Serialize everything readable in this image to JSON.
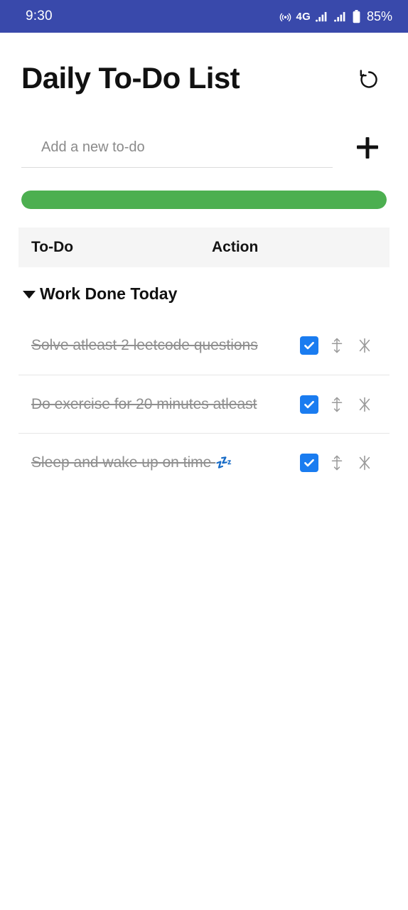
{
  "status_bar": {
    "time": "9:30",
    "hotspot_icon": "hotspot-icon",
    "network_label": "4G",
    "signal_icon_1": "signal-bars-icon",
    "signal_icon_2": "signal-bars-icon",
    "battery_icon": "battery-icon",
    "battery_percent": "85%",
    "background_color": "#3949ab"
  },
  "header": {
    "title": "Daily To-Do List",
    "reset_icon": "reset-circular-arrow-icon"
  },
  "add_todo": {
    "placeholder": "Add a new to-do",
    "value": "",
    "add_icon": "plus-icon"
  },
  "progress": {
    "percent": 100,
    "percent_label": "100%",
    "fill_color": "#4caf50",
    "track_color": "#e8e8e8"
  },
  "table": {
    "columns": [
      "To-Do",
      "Action"
    ],
    "group": {
      "label": "Work Done Today",
      "expanded": true,
      "caret_icon": "caret-down-icon"
    },
    "rows": [
      {
        "text": "Solve atleast 2 leetcode questions",
        "emoji": "",
        "completed": true,
        "checkbox_icon": "checkbox-checked-icon",
        "move_icon": "move-updown-icon",
        "delete_icon": "delete-x-icon"
      },
      {
        "text": "Do exercise for 20 minutes atleast",
        "emoji": "",
        "completed": true,
        "checkbox_icon": "checkbox-checked-icon",
        "move_icon": "move-updown-icon",
        "delete_icon": "delete-x-icon"
      },
      {
        "text": "Sleep and wake up on time ",
        "emoji": "💤",
        "completed": true,
        "checkbox_icon": "checkbox-checked-icon",
        "move_icon": "move-updown-icon",
        "delete_icon": "delete-x-icon"
      }
    ]
  },
  "colors": {
    "accent_blue": "#1a7cf0",
    "status_bar_blue": "#3949ab",
    "progress_green": "#4caf50",
    "text_muted": "#8f8f8f"
  }
}
